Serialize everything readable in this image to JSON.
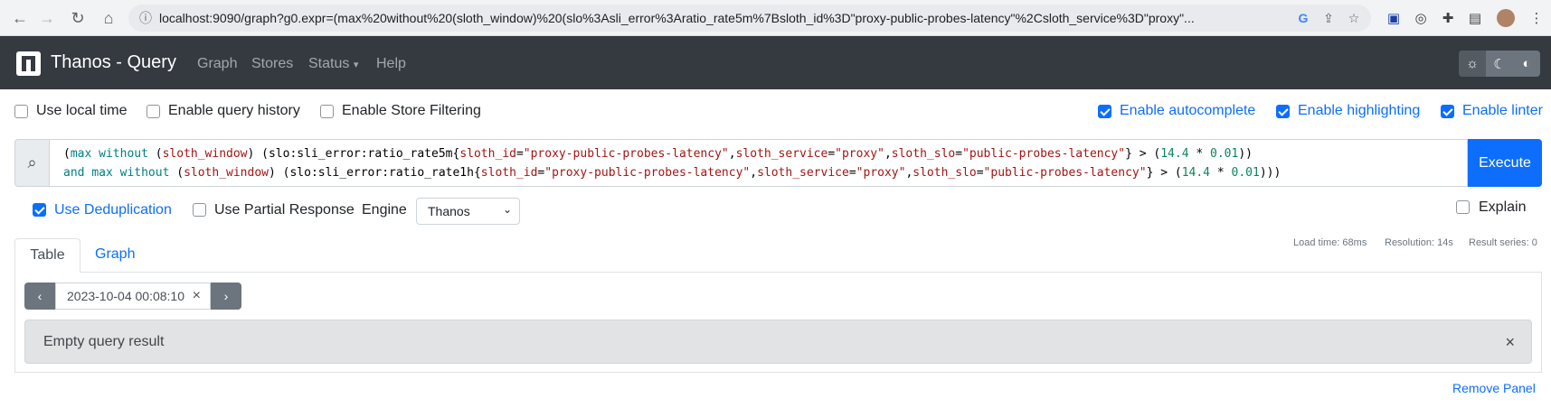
{
  "browser": {
    "url": "localhost:9090/graph?g0.expr=(max%20without%20(sloth_window)%20(slo%3Asli_error%3Aratio_rate5m%7Bsloth_id%3D\"proxy-public-probes-latency\"%2Csloth_service%3D\"proxy\"..."
  },
  "navbar": {
    "brand": "Thanos - Query",
    "links": [
      "Graph",
      "Stores",
      "Status",
      "Help"
    ],
    "status_caret": "▾"
  },
  "options": {
    "use_local_time": "Use local time",
    "enable_query_history": "Enable query history",
    "enable_store_filtering": "Enable Store Filtering",
    "enable_autocomplete": "Enable autocomplete",
    "enable_highlighting": "Enable highlighting",
    "enable_linter": "Enable linter"
  },
  "query": {
    "line1": {
      "p1": "(",
      "kw1": "max without",
      "p2": " (",
      "lbl1": "sloth_window",
      "p3": ") (slo:sli_error:ratio_rate5m{",
      "k1": "sloth_id",
      "eq1": "=",
      "v1": "\"proxy-public-probes-latency\"",
      "c1": ",",
      "k2": "sloth_service",
      "eq2": "=",
      "v2": "\"proxy\"",
      "c2": ",",
      "k3": "sloth_slo",
      "eq3": "=",
      "v3": "\"public-probes-latency\"",
      "p4": "} > (",
      "n1": "14.4",
      "op": " * ",
      "n2": "0.01",
      "p5": "))"
    },
    "line2": {
      "p1": "and ",
      "kw1": "max without",
      "p2": " (",
      "lbl1": "sloth_window",
      "p3": ") (slo:sli_error:ratio_rate1h{",
      "k1": "sloth_id",
      "eq1": "=",
      "v1": "\"proxy-public-probes-latency\"",
      "c1": ",",
      "k2": "sloth_service",
      "eq2": "=",
      "v2": "\"proxy\"",
      "c2": ",",
      "k3": "sloth_slo",
      "eq3": "=",
      "v3": "\"public-probes-latency\"",
      "p4": "} > (",
      "n1": "14.4",
      "op": " * ",
      "n2": "0.01",
      "p5": ")))"
    },
    "execute_label": "Execute"
  },
  "panel_options": {
    "use_deduplication": "Use Deduplication",
    "use_partial_response": "Use Partial Response",
    "engine_label": "Engine",
    "engine_value": "Thanos",
    "explain": "Explain"
  },
  "stats": {
    "load_time": "Load time: 68ms",
    "resolution": "Resolution: 14s",
    "result_series": "Result series: 0"
  },
  "tabs": {
    "table": "Table",
    "graph": "Graph"
  },
  "time": {
    "value": "2023-10-04 00:08:10",
    "prev": "‹",
    "next": "›",
    "clear": "×"
  },
  "result": {
    "message": "Empty query result",
    "close": "×"
  },
  "remove_panel": "Remove Panel",
  "colors": {
    "navbar": "#343a40",
    "primary": "#0d6efd",
    "secondary": "#6c757d"
  }
}
